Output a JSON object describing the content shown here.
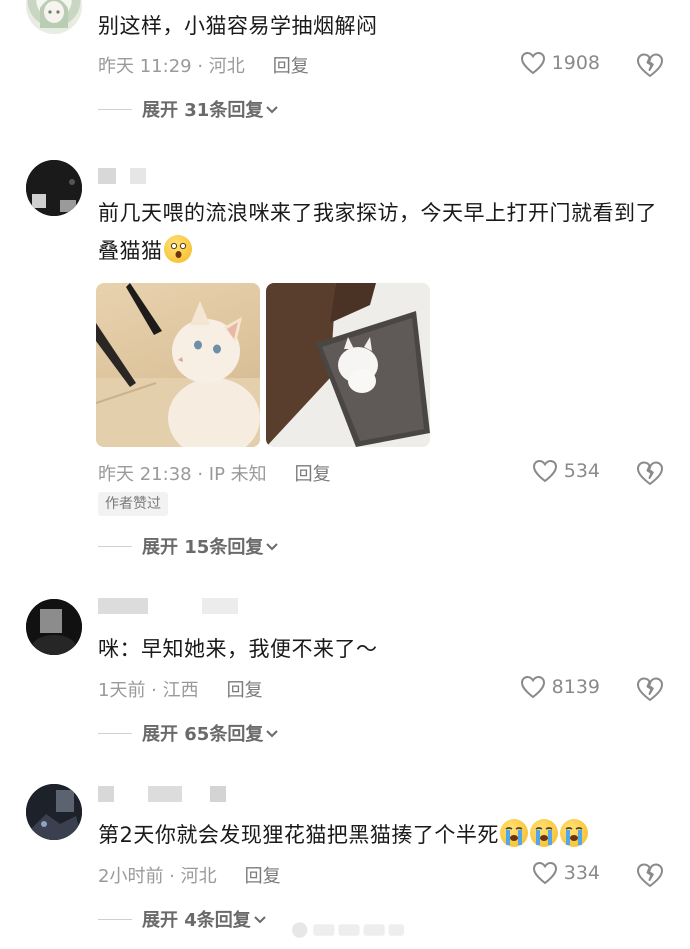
{
  "comments": [
    {
      "text": "别这样，小猫容易学抽烟解闷",
      "time_location": "昨天 11:29 · 河北",
      "reply_label": "回复",
      "likes": "1908",
      "expand_label": "展开 31条回复"
    },
    {
      "text": "前几天喂的流浪咪来了我家探访，今天早上打开门就看到了叠猫猫",
      "time_location": "昨天 21:38 · IP 未知",
      "reply_label": "回复",
      "likes": "534",
      "badge": "作者赞过",
      "expand_label": "展开 15条回复"
    },
    {
      "text": "咪：早知她来，我便不来了～",
      "time_location": "1天前 · 江西",
      "reply_label": "回复",
      "likes": "8139",
      "expand_label": "展开 65条回复"
    },
    {
      "text": "第2天你就会发现狸花猫把黑猫揍了个半死",
      "time_location": "2小时前 · 河北",
      "reply_label": "回复",
      "likes": "334",
      "expand_label": "展开 4条回复"
    }
  ],
  "colors": {
    "text": "#1a1a1a",
    "meta": "#9a9a9a",
    "expand": "#6a6a6a",
    "icon": "#8a8a8a"
  },
  "icons": {
    "like": "heart-outline-icon",
    "dislike": "broken-heart-icon",
    "expand": "chevron-down-icon",
    "emoji_shock": "astonished-face-emoji",
    "emoji_cry": "loudly-crying-face-emoji"
  }
}
